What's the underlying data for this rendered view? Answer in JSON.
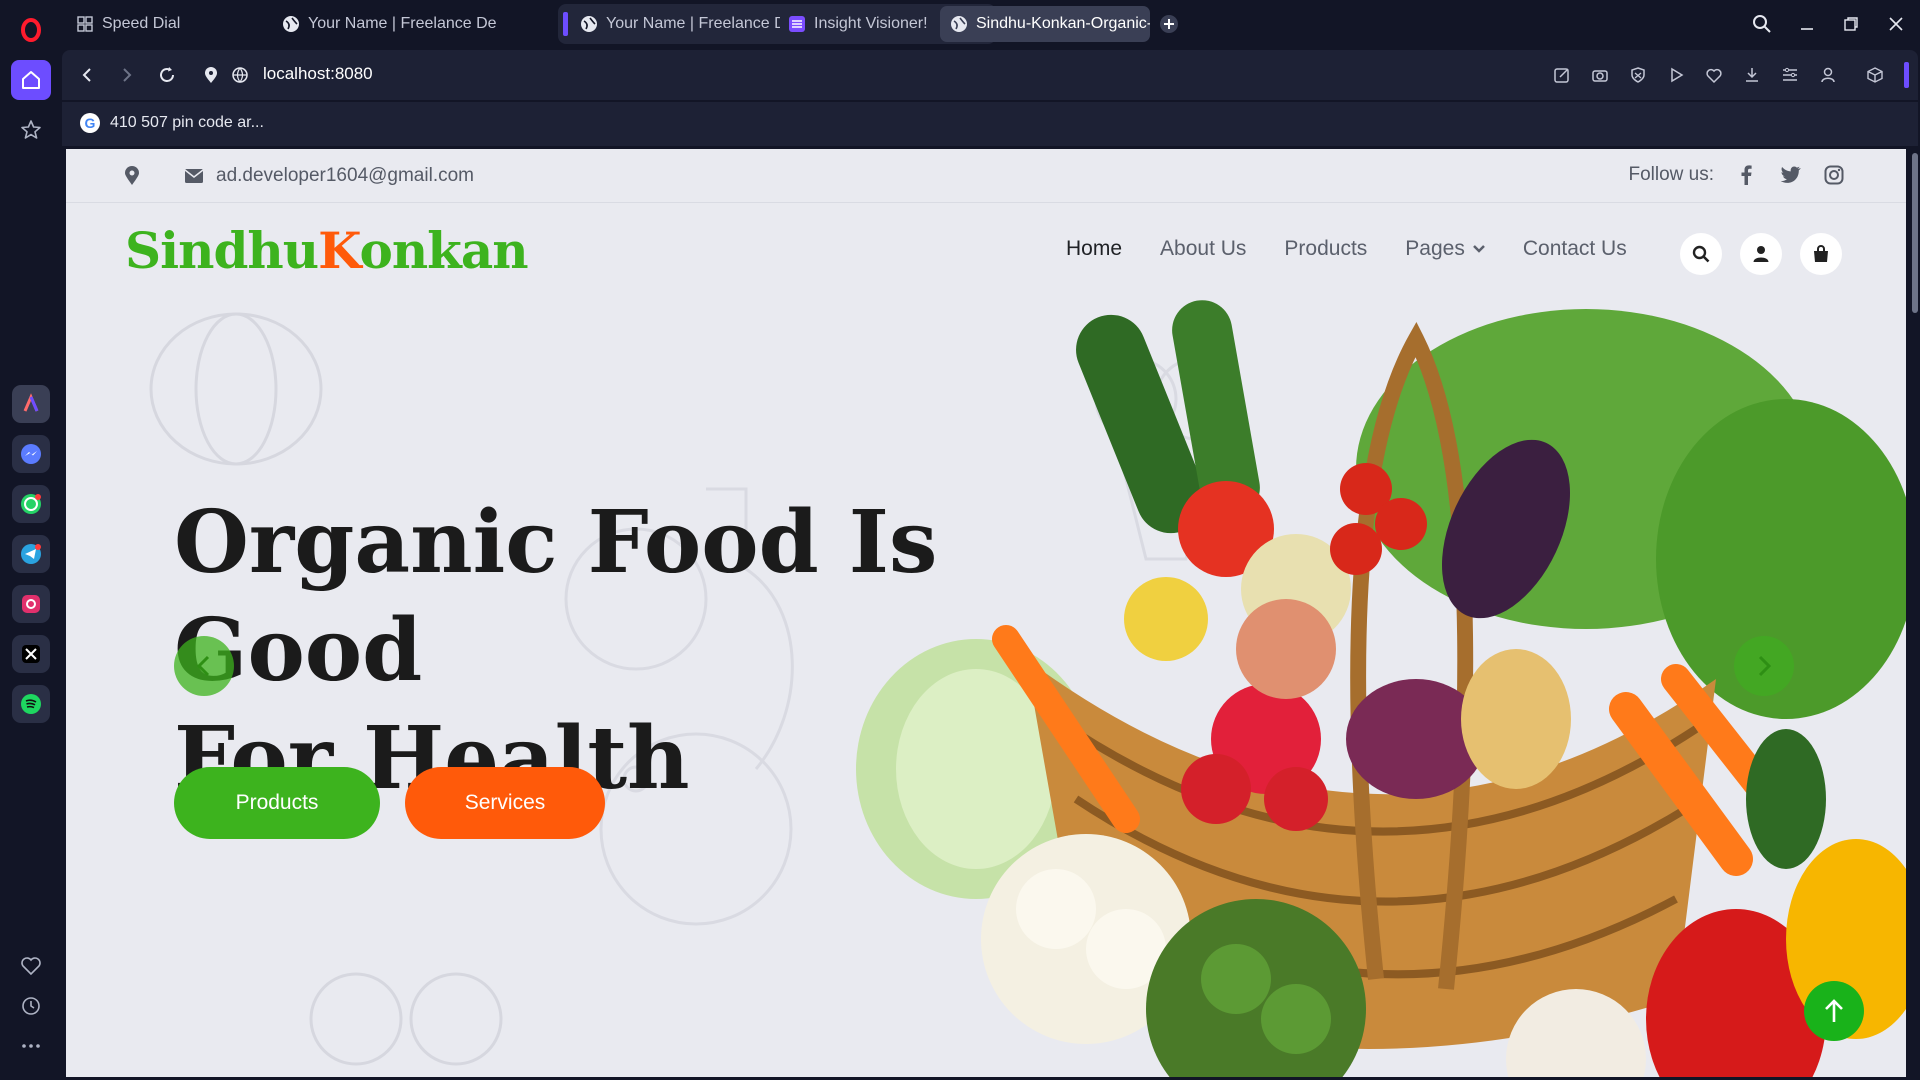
{
  "browser": {
    "tabs": [
      {
        "label": "Speed Dial",
        "icon": "speed-dial-icon"
      },
      {
        "label": "Your Name | Freelance De",
        "icon": "globe-icon"
      },
      {
        "label": "Your Name | Freelance De",
        "icon": "globe-icon"
      },
      {
        "label": "Insight Visioner!",
        "icon": "list-icon"
      },
      {
        "label": "Sindhu-Konkan-Organic-F",
        "icon": "globe-icon",
        "active": true
      }
    ],
    "url": "localhost:8080",
    "bookmark": "410 507 pin code ar..."
  },
  "site": {
    "email": "ad.developer1604@gmail.com",
    "follow_label": "Follow us:",
    "logo_part1": "Sindhu",
    "logo_part2": "Konkan",
    "nav": {
      "home": "Home",
      "about": "About Us",
      "products": "Products",
      "pages": "Pages",
      "contact": "Contact Us"
    },
    "hero": {
      "line1": "Organic Food Is Good",
      "line2": "For Health",
      "btn_products": "Products",
      "btn_services": "Services"
    }
  },
  "colors": {
    "brand_green": "#3db31e",
    "brand_orange": "#ff5a0a",
    "opera_accent": "#6d4dff"
  }
}
